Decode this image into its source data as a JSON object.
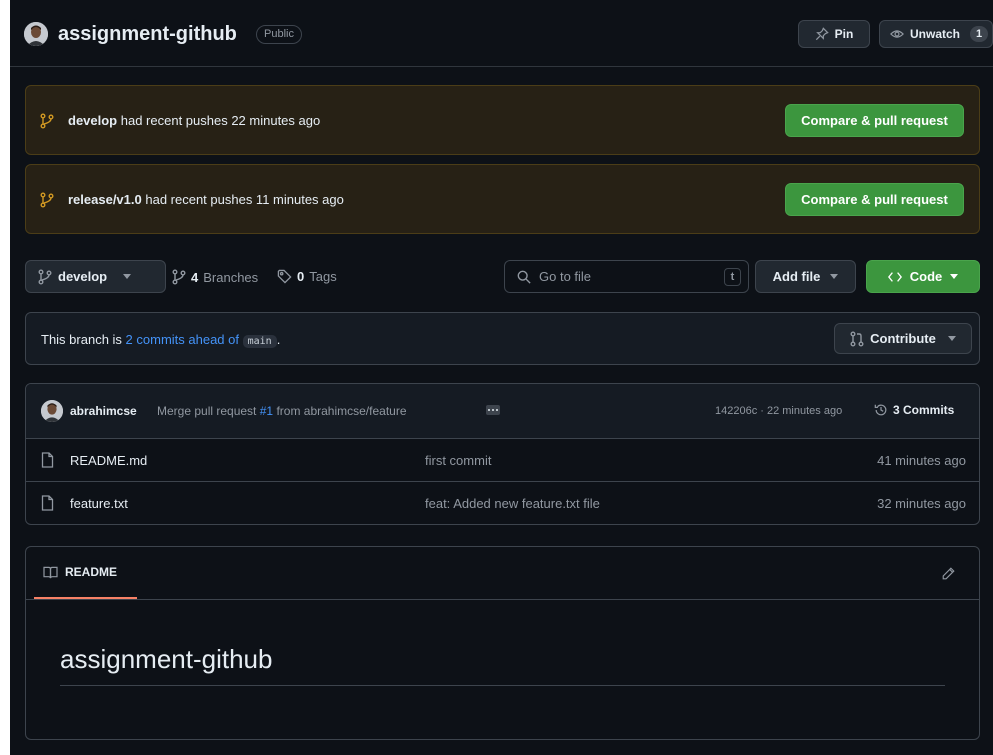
{
  "header": {
    "repo_name": "assignment-github",
    "visibility": "Public",
    "pin_label": "Pin",
    "watch_label": "Unwatch",
    "watch_count": "1"
  },
  "push_banners": [
    {
      "branch": "develop",
      "text": "had recent pushes 22 minutes ago",
      "button": "Compare & pull request"
    },
    {
      "branch": "release/v1.0",
      "text": "had recent pushes 11 minutes ago",
      "button": "Compare & pull request"
    }
  ],
  "toolbar": {
    "branch": "develop",
    "branches_count": "4",
    "branches_label": "Branches",
    "tags_count": "0",
    "tags_label": "Tags",
    "search_placeholder": "Go to file",
    "search_shortcut": "t",
    "add_file_label": "Add file",
    "code_label": "Code"
  },
  "ahead": {
    "prefix": "This branch is",
    "link": "2 commits ahead of",
    "base": "main",
    "suffix": ".",
    "contribute_label": "Contribute"
  },
  "latest_commit": {
    "author": "abrahimcse",
    "msg_prefix": "Merge pull request",
    "pr": "#1",
    "msg_suffix": "from abrahimcse/feature",
    "meta": "142206c · 22 minutes ago",
    "commits_label": "3 Commits"
  },
  "files": [
    {
      "name": "README.md",
      "message": "first commit",
      "time": "41 minutes ago"
    },
    {
      "name": "feature.txt",
      "message": "feat: Added new feature.txt file",
      "time": "32 minutes ago"
    }
  ],
  "readme": {
    "tab_label": "README",
    "heading": "assignment-github"
  },
  "colors": {
    "background": "#0d1117",
    "accent_green": "#3c963e",
    "link_blue": "#4493f8",
    "banner_bg": "#272115",
    "tab_underline": "#f78166"
  },
  "icons": [
    "avatar",
    "pin-icon",
    "eye-icon",
    "git-branch-icon",
    "tag-icon",
    "search-icon",
    "caret-down-icon",
    "code-icon",
    "git-pull-request-icon",
    "history-icon",
    "file-icon",
    "book-icon",
    "pencil-icon"
  ]
}
